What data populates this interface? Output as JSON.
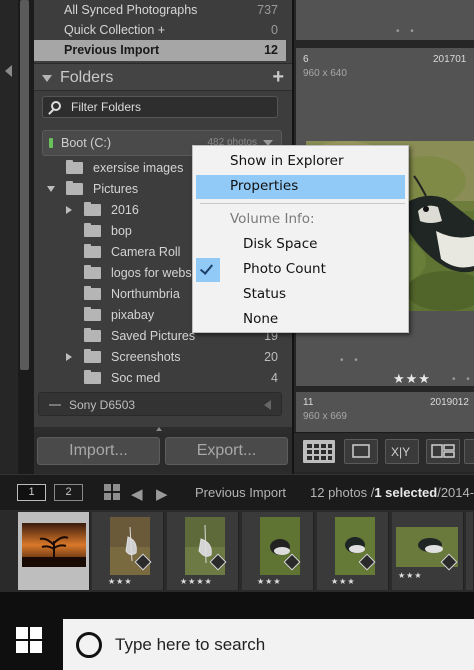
{
  "collections": [
    {
      "label": "All Synced Photographs",
      "count": "737",
      "selected": false
    },
    {
      "label": "Quick Collection +",
      "count": "0",
      "selected": false
    },
    {
      "label": "Previous Import",
      "count": "12",
      "selected": true
    }
  ],
  "folders_panel": {
    "title": "Folders",
    "add_symbol": "+",
    "filter_placeholder": "Filter Folders",
    "volume": {
      "name": "Boot (C:)",
      "count": "482 photos"
    },
    "folders": [
      {
        "label": "exersise images",
        "count": "",
        "expand": "none"
      },
      {
        "label": "Pictures",
        "count": "",
        "expand": "down"
      },
      {
        "label": "2016",
        "count": "",
        "expand": "right"
      },
      {
        "label": "bop",
        "count": "",
        "expand": "none"
      },
      {
        "label": "Camera Roll",
        "count": "",
        "expand": "none"
      },
      {
        "label": "logos for webs",
        "count": "",
        "expand": "none"
      },
      {
        "label": "Northumbria",
        "count": "",
        "expand": "none"
      },
      {
        "label": "pixabay",
        "count": "",
        "expand": "none"
      },
      {
        "label": "Saved Pictures",
        "count": "19",
        "expand": "none"
      },
      {
        "label": "Screenshots",
        "count": "20",
        "expand": "right"
      },
      {
        "label": "Soc med",
        "count": "4",
        "expand": "none"
      }
    ],
    "device": "Sony D6503"
  },
  "buttons": {
    "import": "Import...",
    "export": "Export..."
  },
  "grid": {
    "cell_top": {
      "number": "6",
      "dims": "960 x 640",
      "date": "201701"
    },
    "cell_bottom": {
      "number": "11",
      "dims": "960 x 669",
      "date": "2019012"
    },
    "rating": "★★★",
    "dots": "• •",
    "toolbar": {
      "xy": "X|Y"
    }
  },
  "context_menu": {
    "items": [
      {
        "label": "Show in Explorer",
        "state": "normal"
      },
      {
        "label": "Properties",
        "state": "highlighted"
      },
      {
        "label": "Volume Info:",
        "state": "disabled"
      },
      {
        "label": "Disk Space",
        "state": "normal"
      },
      {
        "label": "Photo Count",
        "state": "checked"
      },
      {
        "label": "Status",
        "state": "normal"
      },
      {
        "label": "None",
        "state": "normal"
      }
    ]
  },
  "filmstrip": {
    "monitor_1": "1",
    "monitor_2": "2",
    "source": "Previous Import",
    "count_prefix": "12 photos /",
    "selected": "1 selected",
    "path_tail": "/2014-",
    "thumbs": [
      {
        "number": "",
        "stars": "",
        "selected": true
      },
      {
        "number": "",
        "stars": "★★★",
        "selected": false
      },
      {
        "number": "",
        "stars": "★★★★",
        "selected": false
      },
      {
        "number": "",
        "stars": "★★★",
        "selected": false
      },
      {
        "number": "",
        "stars": "★★★",
        "selected": false
      },
      {
        "number": "",
        "stars": "★★★",
        "selected": false
      },
      {
        "number": "",
        "stars": "",
        "selected": false
      }
    ]
  },
  "taskbar": {
    "search_placeholder": "Type here to search"
  },
  "colors": {
    "accent_highlight": "#91c9f7",
    "selected_row": "#a6a6a6",
    "led": "#6ac15b"
  }
}
